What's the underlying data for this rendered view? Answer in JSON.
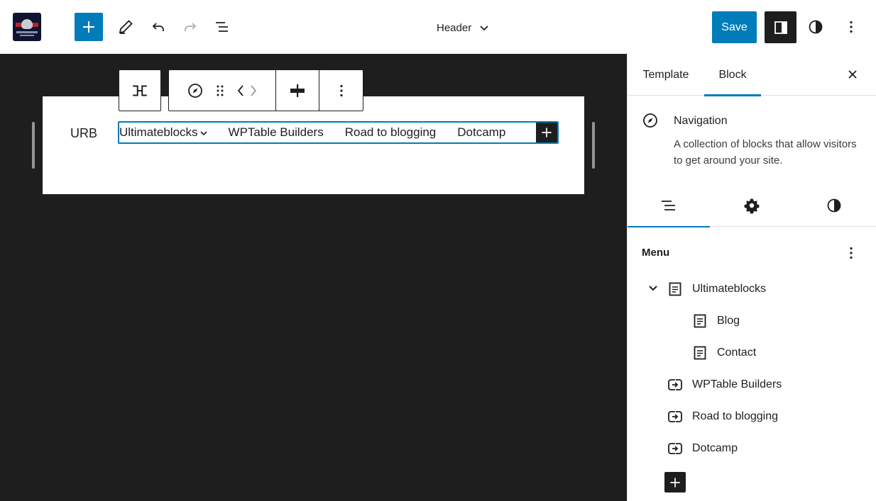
{
  "header": {
    "document_title": "Header",
    "save_label": "Save"
  },
  "icons": {
    "inserter": "plus-icon",
    "tools": "pencil-icon",
    "undo": "undo-icon",
    "redo": "redo-icon",
    "list_view": "list-view-icon",
    "settings": "sidebar-toggle-icon",
    "styles": "half-circle-icon",
    "options": "vertical-dots-icon"
  },
  "canvas": {
    "site_title": "URB",
    "navigation": [
      {
        "label": "Ultimateblocks",
        "has_submenu": true
      },
      {
        "label": "WPTable Builders"
      },
      {
        "label": "Road to blogging"
      },
      {
        "label": "Dotcamp"
      }
    ]
  },
  "sidebar": {
    "tabs": [
      {
        "label": "Template",
        "active": false
      },
      {
        "label": "Block",
        "active": true
      }
    ],
    "block": {
      "title": "Navigation",
      "description": "A collection of blocks that allow visitors to get around your site."
    },
    "inspector_tabs": [
      "list-view-icon",
      "gear-icon",
      "half-circle-icon"
    ],
    "menu": {
      "heading": "Menu",
      "items": [
        {
          "label": "Ultimateblocks",
          "type": "page",
          "level": 0,
          "expanded": true
        },
        {
          "label": "Blog",
          "type": "page",
          "level": 1
        },
        {
          "label": "Contact",
          "type": "page",
          "level": 1
        },
        {
          "label": "WPTable Builders",
          "type": "custom-link",
          "level": 0
        },
        {
          "label": "Road to blogging",
          "type": "custom-link",
          "level": 0
        },
        {
          "label": "Dotcamp",
          "type": "custom-link",
          "level": 0
        }
      ]
    }
  },
  "colors": {
    "accent": "#007cba",
    "dark": "#1e1e1e",
    "canvas_bg": "#1e1e1e"
  }
}
